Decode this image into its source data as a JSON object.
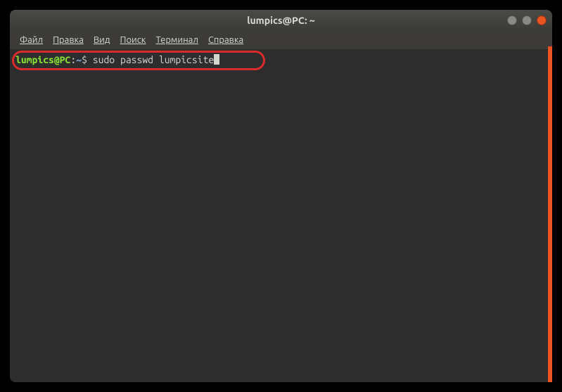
{
  "titlebar": {
    "title": "lumpics@PC: ~"
  },
  "menubar": {
    "items": [
      {
        "label": "Файл"
      },
      {
        "label": "Правка"
      },
      {
        "label": "Вид"
      },
      {
        "label": "Поиск"
      },
      {
        "label": "Терминал"
      },
      {
        "label": "Справка"
      }
    ]
  },
  "prompt": {
    "user_host": "lumpics@PC",
    "colon": ":",
    "path": "~",
    "dollar": "$ ",
    "command": "sudo passwd lumpicsite"
  }
}
